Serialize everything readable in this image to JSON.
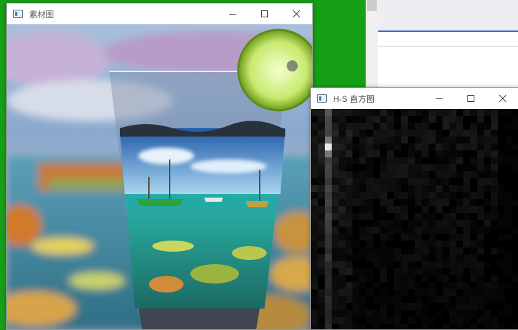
{
  "windows": {
    "source": {
      "title": "素材图"
    },
    "histogram": {
      "title": "H-S 直方图"
    }
  },
  "icons": [
    "app-icon",
    "minimize-icon",
    "maximize-icon",
    "close-icon"
  ],
  "colors": {
    "desktop_green": "#16a016",
    "titlebar": "#ffffff",
    "accent_blue": "#2b6fc9",
    "histogram_bg": "#000000"
  }
}
